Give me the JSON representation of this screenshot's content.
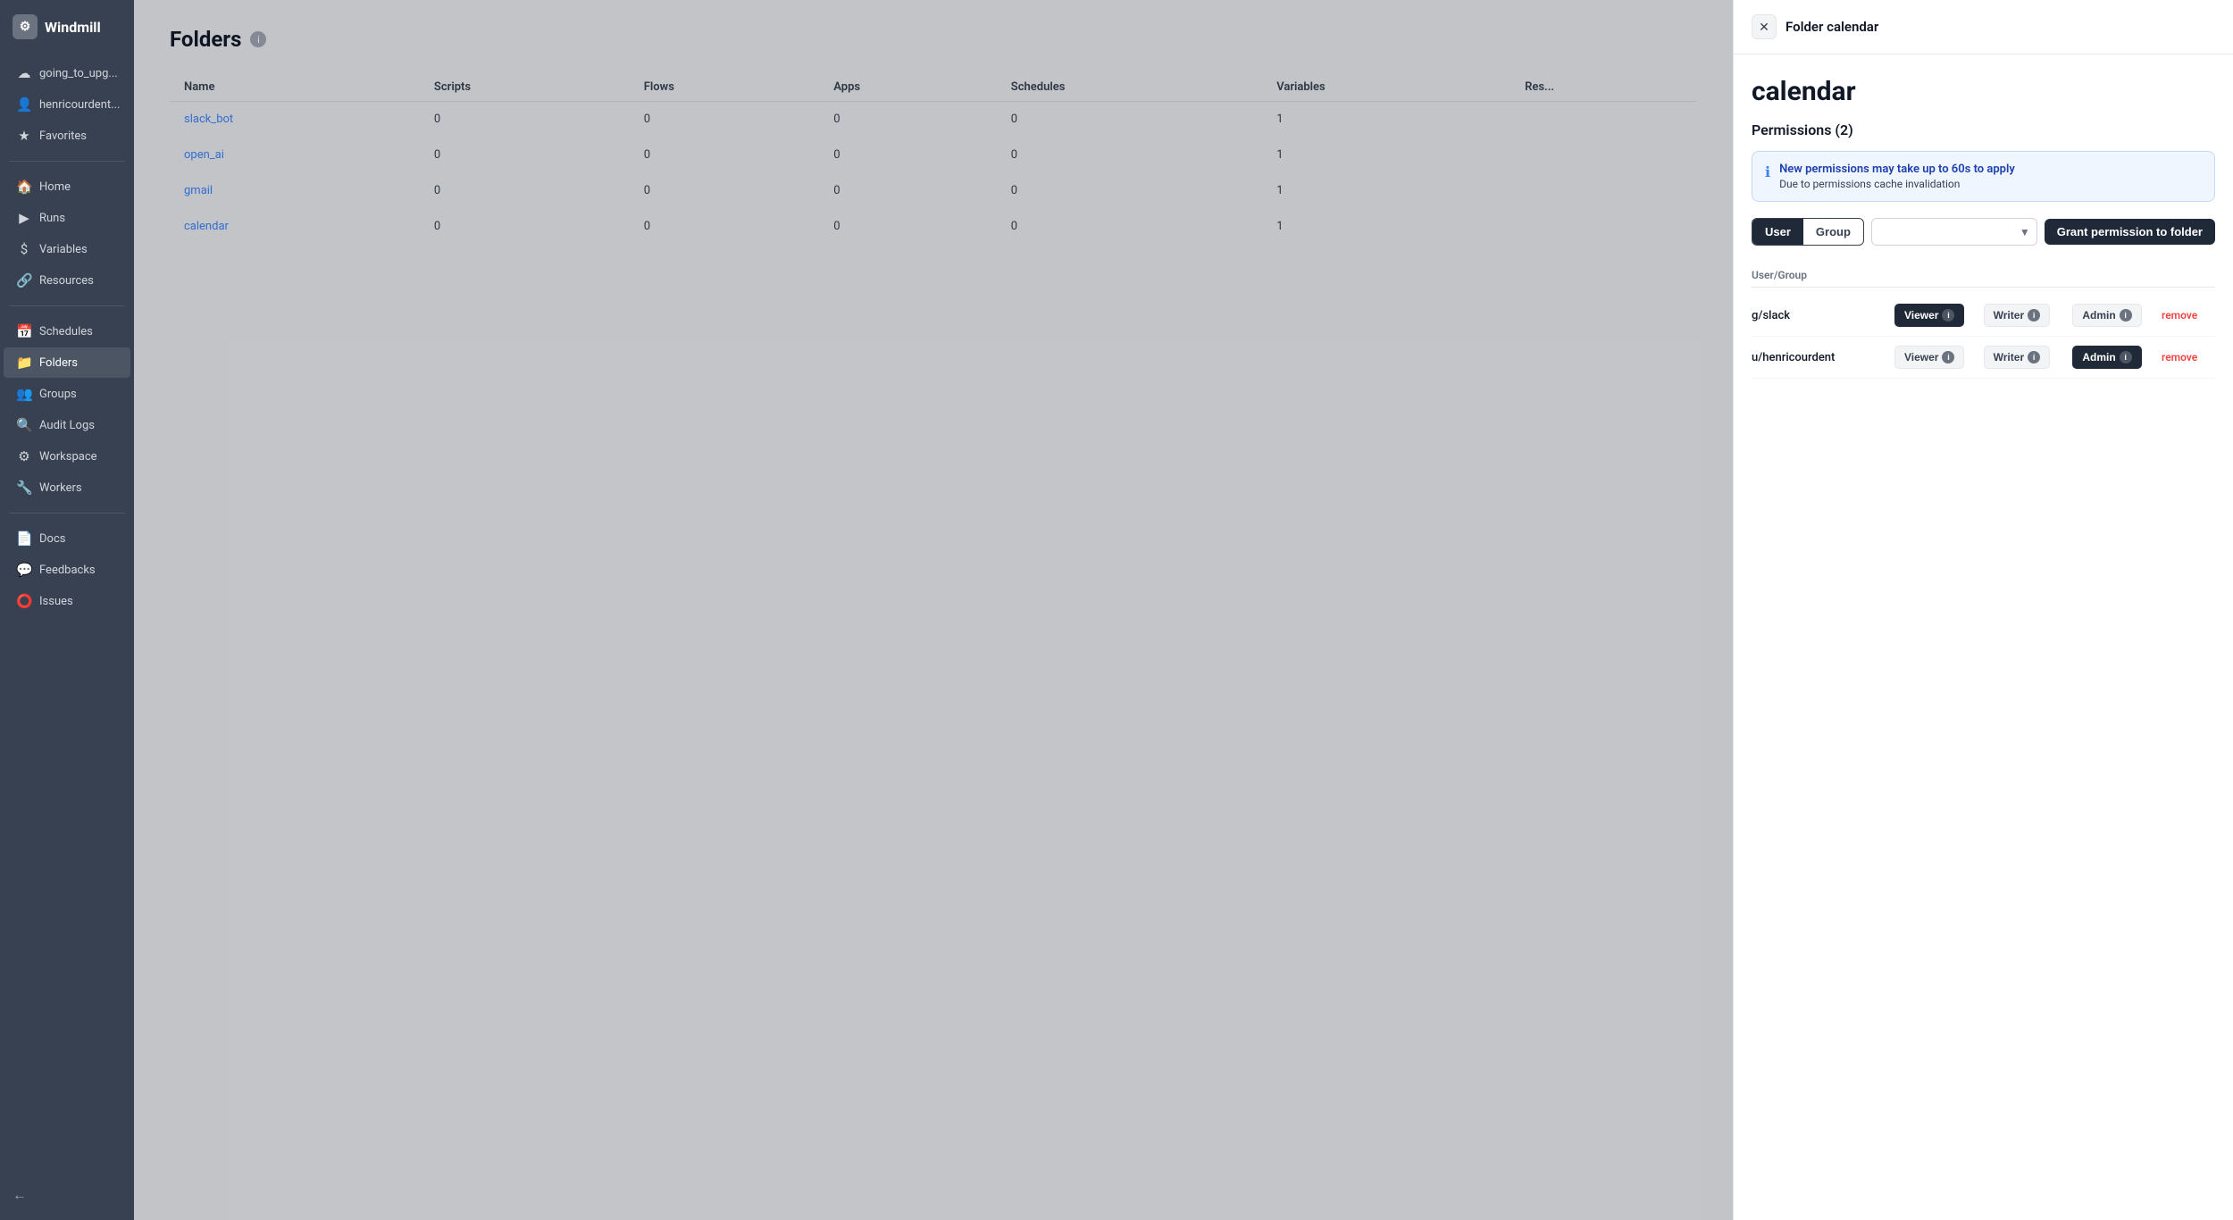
{
  "app": {
    "name": "Windmill"
  },
  "sidebar": {
    "workspace_label": "going_to_upg...",
    "user_label": "henricourdent...",
    "favorites_label": "Favorites",
    "nav_items": [
      {
        "id": "home",
        "label": "Home",
        "icon": "🏠"
      },
      {
        "id": "runs",
        "label": "Runs",
        "icon": "▶"
      },
      {
        "id": "variables",
        "label": "Variables",
        "icon": "$"
      },
      {
        "id": "resources",
        "label": "Resources",
        "icon": "🔗"
      }
    ],
    "management_items": [
      {
        "id": "schedules",
        "label": "Schedules",
        "icon": "📅"
      },
      {
        "id": "folders",
        "label": "Folders",
        "icon": "📁",
        "active": true
      },
      {
        "id": "groups",
        "label": "Groups",
        "icon": "👥"
      },
      {
        "id": "audit-logs",
        "label": "Audit Logs",
        "icon": "🔍"
      },
      {
        "id": "workspace",
        "label": "Workspace",
        "icon": "⚙"
      },
      {
        "id": "workers",
        "label": "Workers",
        "icon": "🔧"
      }
    ],
    "footer_items": [
      {
        "id": "docs",
        "label": "Docs",
        "icon": "📄"
      },
      {
        "id": "feedbacks",
        "label": "Feedbacks",
        "icon": "💬"
      },
      {
        "id": "issues",
        "label": "Issues",
        "icon": "⭕"
      }
    ],
    "back_label": "←"
  },
  "main": {
    "title": "Folders",
    "table": {
      "columns": [
        "Name",
        "Scripts",
        "Flows",
        "Apps",
        "Schedules",
        "Variables",
        "Res..."
      ],
      "rows": [
        {
          "name": "slack_bot",
          "scripts": 0,
          "flows": 0,
          "apps": 0,
          "schedules": 0,
          "variables": 1
        },
        {
          "name": "open_ai",
          "scripts": 0,
          "flows": 0,
          "apps": 0,
          "schedules": 0,
          "variables": 1
        },
        {
          "name": "gmail",
          "scripts": 0,
          "flows": 0,
          "apps": 0,
          "schedules": 0,
          "variables": 1
        },
        {
          "name": "calendar",
          "scripts": 0,
          "flows": 0,
          "apps": 0,
          "schedules": 0,
          "variables": 1
        }
      ]
    }
  },
  "panel": {
    "header_title": "Folder calendar",
    "folder_name": "calendar",
    "permissions_title": "Permissions (2)",
    "info_banner": {
      "title": "New permissions may take up to 60s to apply",
      "subtitle": "Due to permissions cache invalidation"
    },
    "toggle_user": "User",
    "toggle_group": "Group",
    "select_placeholder": "",
    "grant_button": "Grant permission to folder",
    "perm_table_header": "User/Group",
    "permissions": [
      {
        "name": "g/slack",
        "viewer_active": true,
        "writer_active": false,
        "admin_active": false
      },
      {
        "name": "u/henricourdent",
        "viewer_active": false,
        "writer_active": false,
        "admin_active": true
      }
    ],
    "viewer_label": "Viewer",
    "writer_label": "Writer",
    "admin_label": "Admin",
    "remove_label": "remove"
  }
}
